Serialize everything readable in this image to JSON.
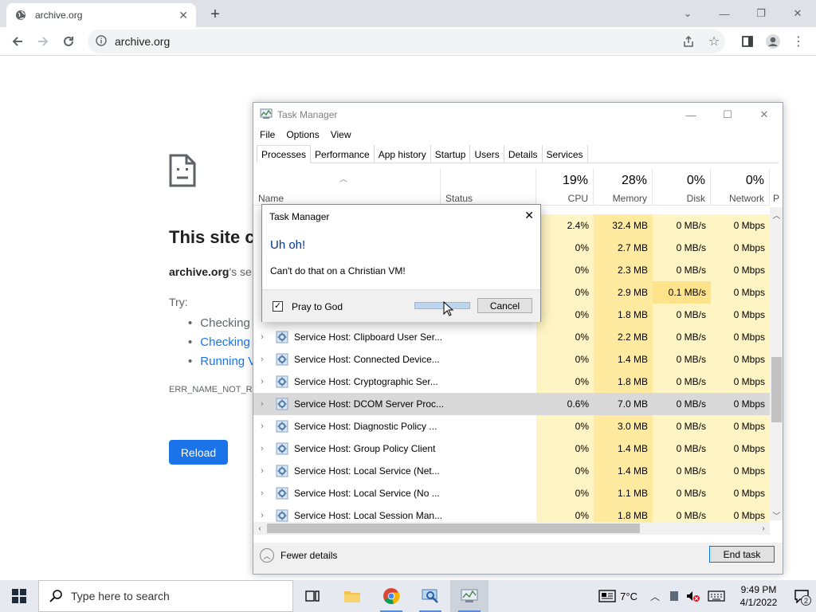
{
  "browser": {
    "tab_title": "archive.org",
    "url": "archive.org"
  },
  "error_page": {
    "title": "This site c",
    "subtitle_domain": "archive.org",
    "subtitle_rest": "'s se",
    "try_label": "Try:",
    "suggestions": [
      "Checking",
      "Checking",
      "Running V"
    ],
    "error_code": "ERR_NAME_NOT_RE",
    "reload_label": "Reload"
  },
  "task_manager": {
    "title": "Task Manager",
    "menu": [
      "File",
      "Options",
      "View"
    ],
    "tabs": [
      "Processes",
      "Performance",
      "App history",
      "Startup",
      "Users",
      "Details",
      "Services"
    ],
    "columns": {
      "name": "Name",
      "status": "Status",
      "cpu": {
        "pct": "19%",
        "label": "CPU"
      },
      "memory": {
        "pct": "28%",
        "label": "Memory"
      },
      "disk": {
        "pct": "0%",
        "label": "Disk"
      },
      "network": {
        "pct": "0%",
        "label": "Network"
      },
      "power": "P"
    },
    "rows": [
      {
        "name": "",
        "cpu": "2.4%",
        "mem": "32.4 MB",
        "disk": "0 MB/s",
        "net": "0 Mbps"
      },
      {
        "name": "",
        "cpu": "0%",
        "mem": "2.7 MB",
        "disk": "0 MB/s",
        "net": "0 Mbps"
      },
      {
        "name": "",
        "cpu": "0%",
        "mem": "2.3 MB",
        "disk": "0 MB/s",
        "net": "0 Mbps"
      },
      {
        "name": "",
        "cpu": "0%",
        "mem": "2.9 MB",
        "disk": "0.1 MB/s",
        "net": "0 Mbps"
      },
      {
        "name": "",
        "cpu": "0%",
        "mem": "1.8 MB",
        "disk": "0 MB/s",
        "net": "0 Mbps"
      },
      {
        "name": "Service Host: Clipboard User Ser...",
        "cpu": "0%",
        "mem": "2.2 MB",
        "disk": "0 MB/s",
        "net": "0 Mbps"
      },
      {
        "name": "Service Host: Connected Device...",
        "cpu": "0%",
        "mem": "1.4 MB",
        "disk": "0 MB/s",
        "net": "0 Mbps"
      },
      {
        "name": "Service Host: Cryptographic Ser...",
        "cpu": "0%",
        "mem": "1.8 MB",
        "disk": "0 MB/s",
        "net": "0 Mbps"
      },
      {
        "name": "Service Host: DCOM Server Proc...",
        "cpu": "0.6%",
        "mem": "7.0 MB",
        "disk": "0 MB/s",
        "net": "0 Mbps"
      },
      {
        "name": "Service Host: Diagnostic Policy ...",
        "cpu": "0%",
        "mem": "3.0 MB",
        "disk": "0 MB/s",
        "net": "0 Mbps"
      },
      {
        "name": "Service Host: Group Policy Client",
        "cpu": "0%",
        "mem": "1.4 MB",
        "disk": "0 MB/s",
        "net": "0 Mbps"
      },
      {
        "name": "Service Host: Local Service (Net...",
        "cpu": "0%",
        "mem": "1.4 MB",
        "disk": "0 MB/s",
        "net": "0 Mbps"
      },
      {
        "name": "Service Host: Local Service (No ...",
        "cpu": "0%",
        "mem": "1.1 MB",
        "disk": "0 MB/s",
        "net": "0 Mbps"
      },
      {
        "name": "Service Host: Local Session Man...",
        "cpu": "0%",
        "mem": "1.8 MB",
        "disk": "0 MB/s",
        "net": "0 Mbps"
      }
    ],
    "fewer_details": "Fewer details",
    "end_task": "End task"
  },
  "dialog": {
    "title": "Task Manager",
    "main_instruction": "Uh oh!",
    "message": "Can't do that on a Christian VM!",
    "checkbox_label": "Pray to God",
    "checkbox_checked": true,
    "progress_fraction": 1.0,
    "cancel_label": "Cancel"
  },
  "taskbar": {
    "search_placeholder": "Type here to search",
    "temperature": "7°C",
    "time": "9:49 PM",
    "date": "4/1/2022",
    "notification_count": "2"
  },
  "colors": {
    "chrome_blue": "#1a73e8",
    "dialog_heading": "#003399",
    "heat_light": "#fff4c4",
    "heat_mid": "#ffeaa0"
  }
}
